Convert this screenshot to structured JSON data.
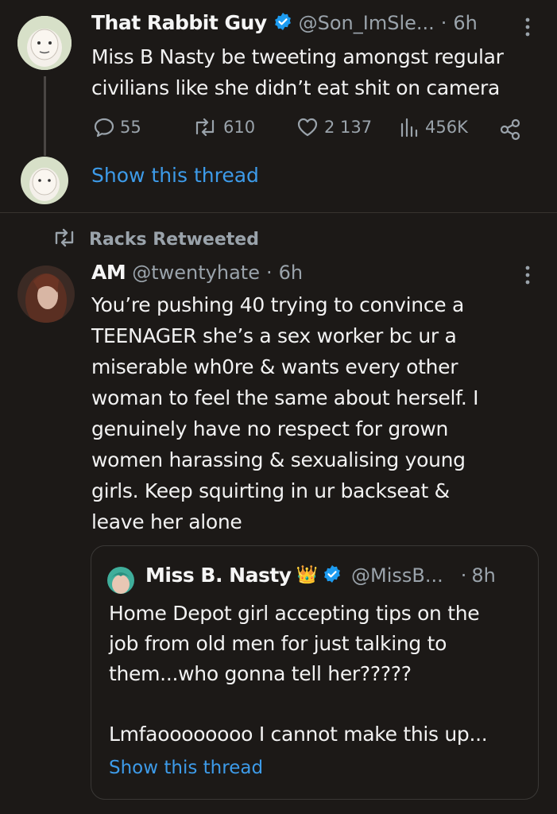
{
  "tweet1": {
    "display_name": "That Rabbit Guy",
    "handle": "@Son_ImSle...",
    "separator": "·",
    "time": "6h",
    "text_line1": "Miss B Nasty be tweeting amongst regular",
    "text_line2": "civilians like she didn’t eat shit on camera",
    "stats": {
      "replies": "55",
      "retweets": "610",
      "likes": "2 137",
      "views": "456K"
    },
    "show_thread": "Show this thread"
  },
  "retweet_banner": {
    "label": "Racks Retweeted"
  },
  "tweet2": {
    "display_name": "AM",
    "handle": "@twentyhate",
    "separator": "·",
    "time": "6h",
    "lines": [
      "You’re pushing 40 trying to convince a",
      "TEENAGER she’s a sex worker bc ur a",
      "miserable wh0re & wants every other",
      "woman to feel the same about herself. I",
      "genuinely have no respect for grown",
      "women harassing & sexualising young",
      "girls. Keep squirting in ur backseat &",
      "leave her alone"
    ]
  },
  "quoted": {
    "display_name": "Miss B. Nasty",
    "emoji": "👑",
    "handle": "@MissB...",
    "separator": "·",
    "time": "8h",
    "lines": [
      "Home Depot girl accepting tips on the",
      "job from old men for just talking to",
      "them...who gonna tell her?????",
      "",
      "Lmfaoooooooo I cannot make this up..."
    ],
    "show_thread": "Show this thread"
  },
  "colors": {
    "background": "#1c1917",
    "link": "#3d9be9",
    "verified": "#1d9bf0",
    "muted": "#9aa3ab"
  }
}
